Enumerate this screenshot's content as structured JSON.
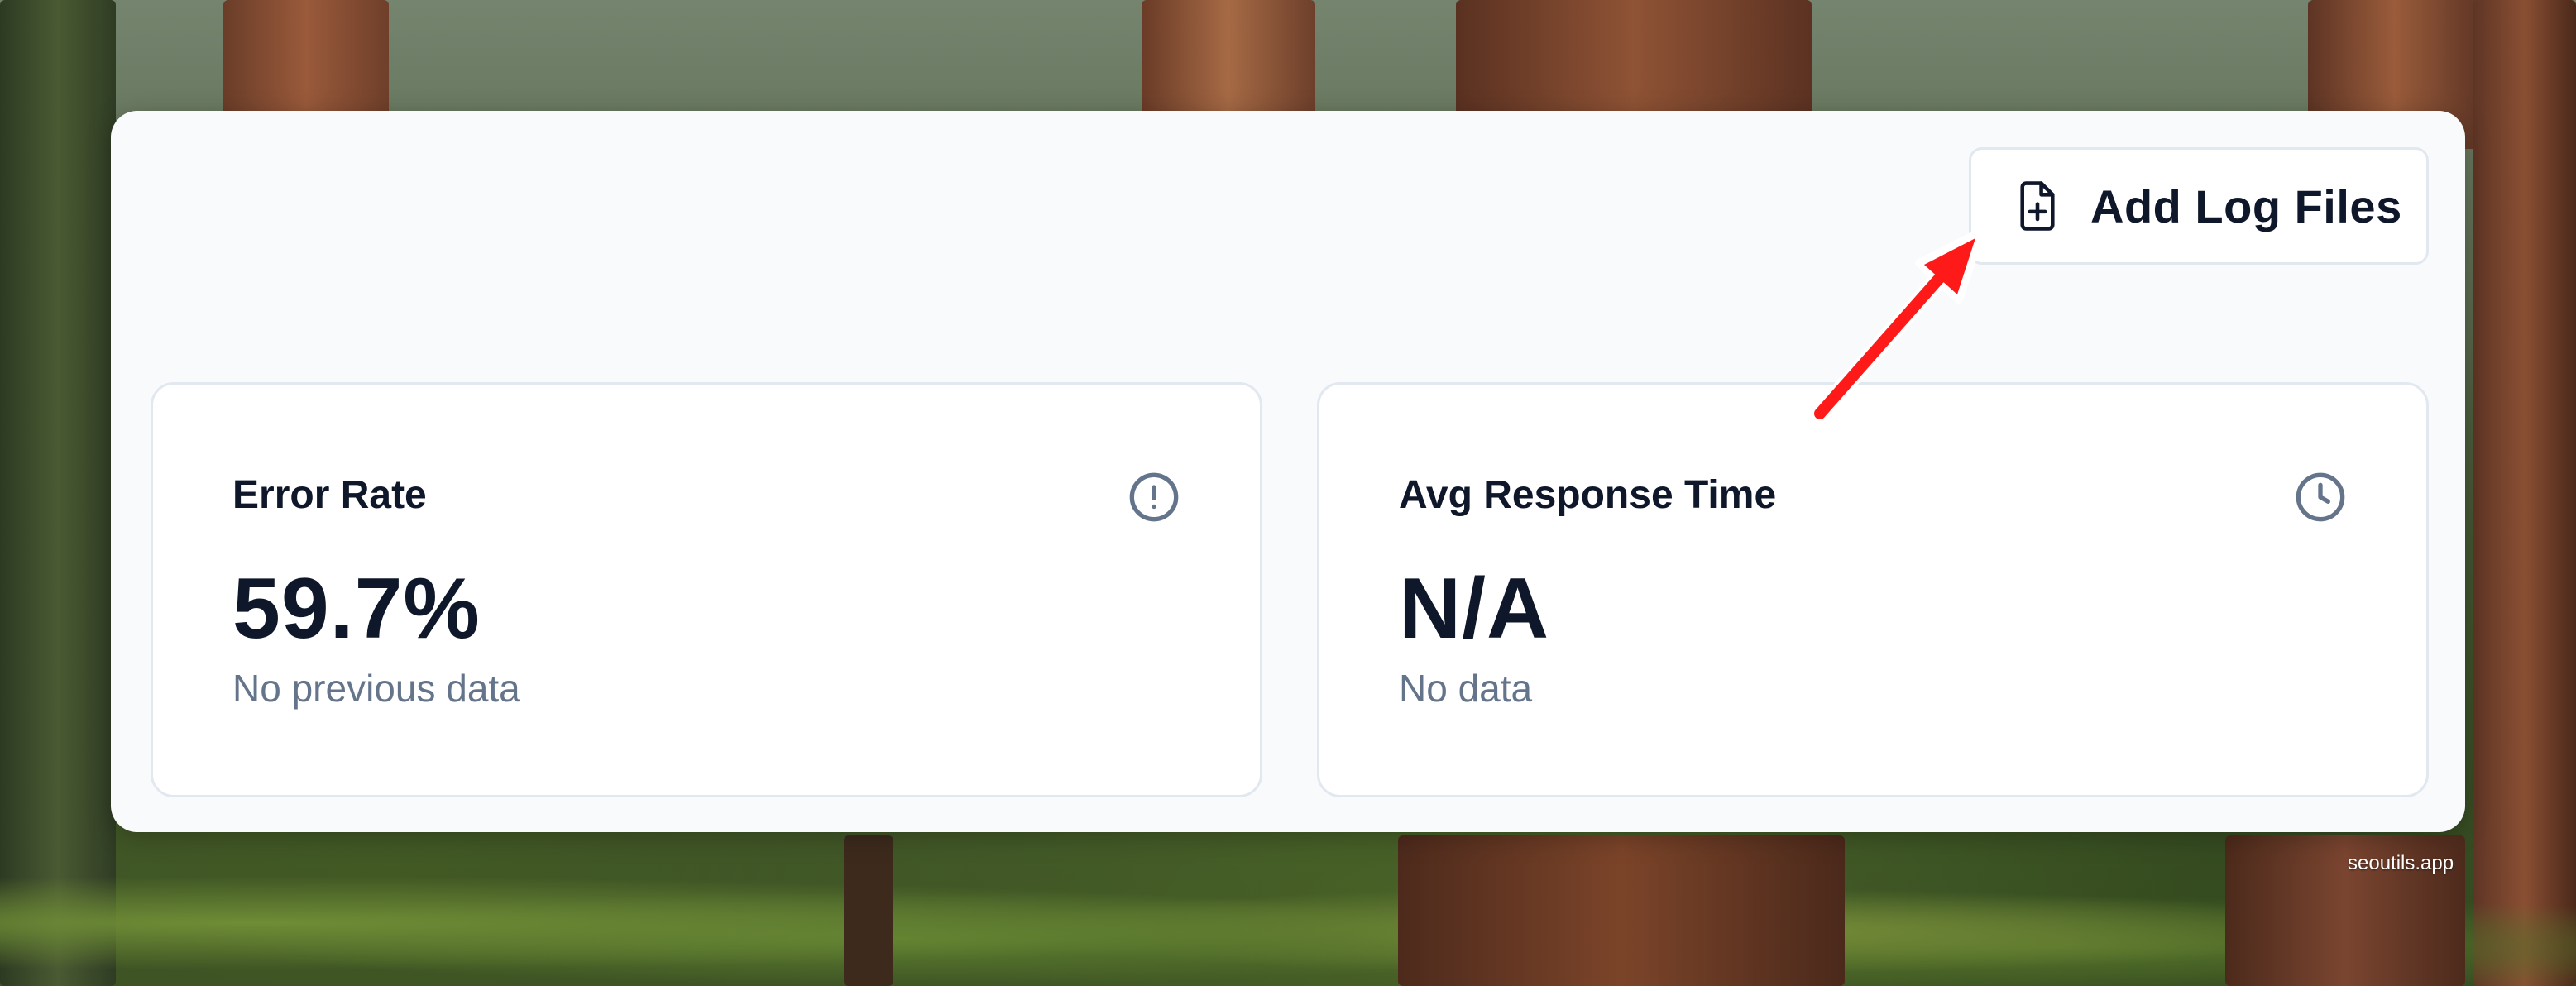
{
  "toolbar": {
    "add_log_files_label": "Add Log Files",
    "add_log_files_icon": "file-plus-icon"
  },
  "cards": [
    {
      "title": "Error Rate",
      "value": "59.7%",
      "subtitle": "No previous data",
      "icon": "alert-circle-icon"
    },
    {
      "title": "Avg Response Time",
      "value": "N/A",
      "subtitle": "No data",
      "icon": "clock-icon"
    }
  ],
  "annotation": {
    "arrow_color": "#ff1a1a",
    "points_to": "add-log-files-button"
  },
  "watermark": "seoutils.app",
  "colors": {
    "panel_bg": "#f8fafc",
    "text_primary": "#0f172a",
    "text_muted": "#64748b",
    "border": "#e2e8f0"
  }
}
